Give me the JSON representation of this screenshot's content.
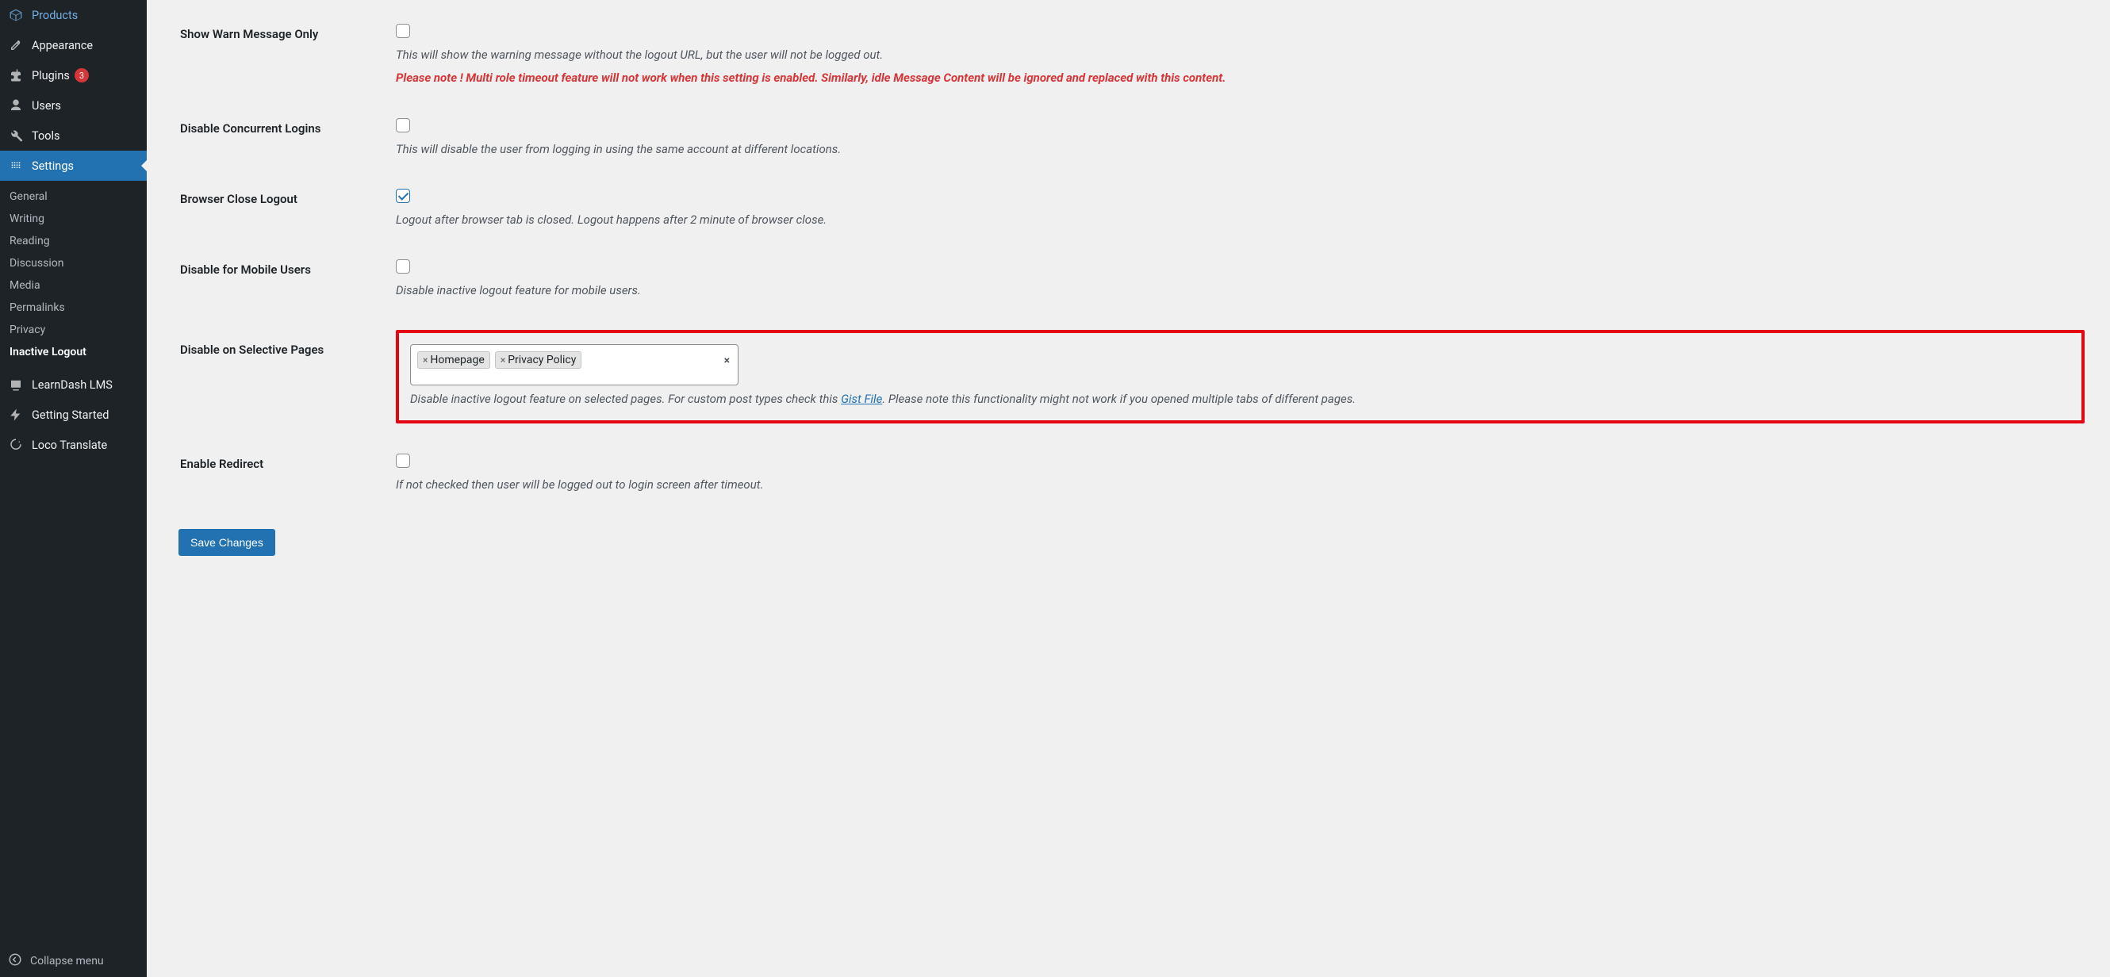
{
  "sidebar": {
    "menu": [
      {
        "id": "products",
        "label": "Products",
        "icon": "products-icon"
      },
      {
        "id": "appearance",
        "label": "Appearance",
        "icon": "appearance-icon"
      },
      {
        "id": "plugins",
        "label": "Plugins",
        "icon": "plugins-icon",
        "badge": "3"
      },
      {
        "id": "users",
        "label": "Users",
        "icon": "users-icon"
      },
      {
        "id": "tools",
        "label": "Tools",
        "icon": "tools-icon"
      },
      {
        "id": "settings",
        "label": "Settings",
        "icon": "settings-icon",
        "active": true
      },
      {
        "id": "learndash",
        "label": "LearnDash LMS",
        "icon": "learndash-icon"
      },
      {
        "id": "getting_started",
        "label": "Getting Started",
        "icon": "getting-started-icon"
      },
      {
        "id": "loco",
        "label": "Loco Translate",
        "icon": "loco-icon"
      }
    ],
    "submenu": [
      {
        "label": "General"
      },
      {
        "label": "Writing"
      },
      {
        "label": "Reading"
      },
      {
        "label": "Discussion"
      },
      {
        "label": "Media"
      },
      {
        "label": "Permalinks"
      },
      {
        "label": "Privacy"
      },
      {
        "label": "Inactive Logout",
        "current": true
      }
    ],
    "collapse_label": "Collapse menu"
  },
  "settings": {
    "show_warn": {
      "label": "Show Warn Message Only",
      "checked": false,
      "desc": "This will show the warning message without the logout URL, but the user will not be logged out.",
      "warn": "Please note ! Multi role timeout feature will not work when this setting is enabled. Similarly, idle Message Content will be ignored and replaced with this content."
    },
    "disable_concurrent": {
      "label": "Disable Concurrent Logins",
      "checked": false,
      "desc": "This will disable the user from logging in using the same account at different locations."
    },
    "browser_close": {
      "label": "Browser Close Logout",
      "checked": true,
      "desc": "Logout after browser tab is closed. Logout happens after 2 minute of browser close."
    },
    "disable_mobile": {
      "label": "Disable for Mobile Users",
      "checked": false,
      "desc": "Disable inactive logout feature for mobile users."
    },
    "disable_pages": {
      "label": "Disable on Selective Pages",
      "tags": [
        "Homepage",
        "Privacy Policy"
      ],
      "desc_pre": "Disable inactive logout feature on selected pages. For custom post types check this ",
      "gist_text": "Gist File",
      "desc_post": ". Please note this functionality might not work if you opened multiple tabs of different pages."
    },
    "enable_redirect": {
      "label": "Enable Redirect",
      "checked": false,
      "desc": "If not checked then user will be logged out to login screen after timeout."
    }
  },
  "save_label": "Save Changes",
  "icons": {
    "tag_close": "×",
    "clear_all": "×"
  }
}
